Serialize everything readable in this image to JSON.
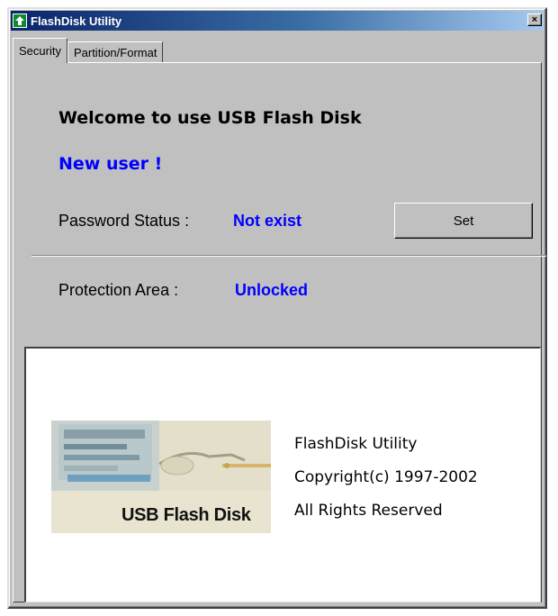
{
  "window": {
    "title": "FlashDisk Utility",
    "close_label": "×",
    "colors": {
      "titlebar": "#0a246a",
      "face": "#c0c0c0",
      "accent": "#0000ff"
    }
  },
  "tabs": [
    {
      "label": "Security",
      "active": true
    },
    {
      "label": "Partition/Format",
      "active": false
    }
  ],
  "security": {
    "welcome": "Welcome to use USB Flash Disk",
    "user_status": "New user !",
    "password_label": "Password Status :",
    "password_value": "Not exist",
    "set_button": "Set",
    "protection_label": "Protection Area :",
    "protection_value": "Unlocked"
  },
  "about": {
    "logo_text": "USB Flash Disk",
    "logo_icon": "usb-flash-disk-photo",
    "lines": [
      "FlashDisk Utility",
      "Copyright(c) 1997-2002",
      "All Rights Reserved"
    ]
  }
}
